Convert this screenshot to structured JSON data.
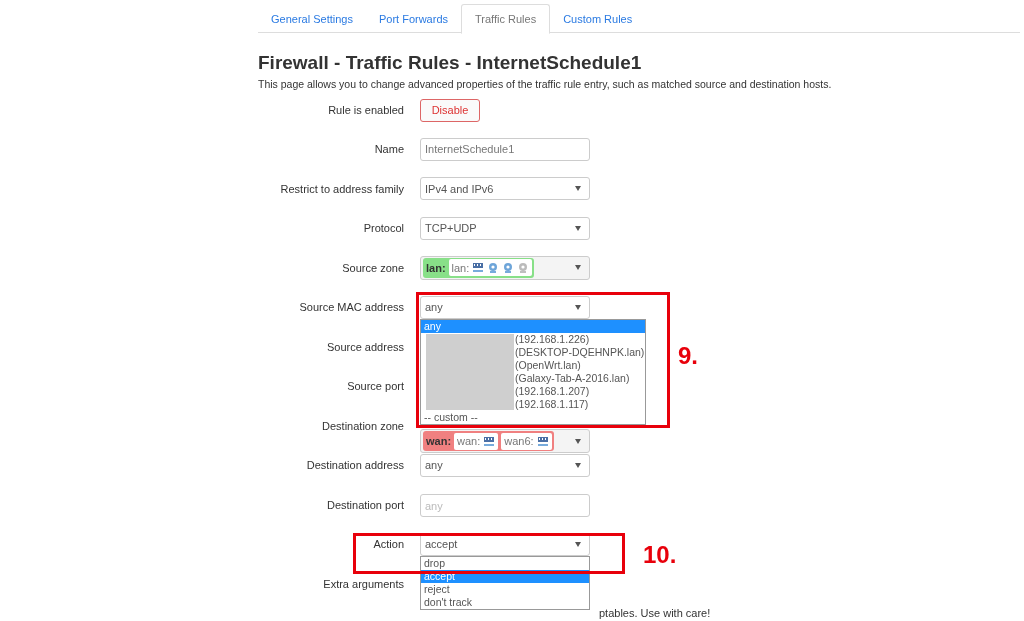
{
  "tabs": [
    {
      "label": "General Settings",
      "selected": false
    },
    {
      "label": "Port Forwards",
      "selected": false
    },
    {
      "label": "Traffic Rules",
      "selected": true
    },
    {
      "label": "Custom Rules",
      "selected": false
    }
  ],
  "title": "Firewall - Traffic Rules - InternetSchedule1",
  "description": "This page allows you to change advanced properties of the traffic rule entry, such as matched source and destination hosts.",
  "fields": [
    {
      "kind": "button",
      "label": "Rule is enabled",
      "value": "Disable"
    },
    {
      "kind": "input",
      "label": "Name",
      "value": "InternetSchedule1"
    },
    {
      "kind": "select",
      "label": "Restrict to address family",
      "value": "IPv4 and IPv6"
    },
    {
      "kind": "select",
      "label": "Protocol",
      "value": "TCP+UDP"
    },
    {
      "kind": "zone",
      "label": "Source zone",
      "zone": {
        "name": "lan:",
        "color": "#88e088",
        "networks": [
          {
            "label": "lan:",
            "devices": [
              {
                "kind": "switch"
              },
              {
                "kind": "wifi"
              },
              {
                "kind": "wifi"
              },
              {
                "kind": "wifi-off"
              }
            ]
          }
        ]
      }
    },
    {
      "kind": "select",
      "label": "Source MAC address",
      "value": "any",
      "options": [
        {
          "label": "any",
          "selected": true
        },
        {
          "label": "(192.168.1.226)",
          "selected": false
        },
        {
          "label": "(DESKTOP-DQEHNPK.lan)",
          "selected": false
        },
        {
          "label": "(OpenWrt.lan)",
          "selected": false
        },
        {
          "label": "(Galaxy-Tab-A-2016.lan)",
          "selected": false
        },
        {
          "label": "(192.168.1.207)",
          "selected": false
        },
        {
          "label": "(192.168.1.117)",
          "selected": false
        },
        {
          "label": "-- custom --",
          "selected": false
        }
      ]
    },
    {
      "kind": "label",
      "label": "Source address"
    },
    {
      "kind": "label",
      "label": "Source port"
    },
    {
      "kind": "zone",
      "label": "Destination zone",
      "zone": {
        "name": "wan:",
        "color": "#f08080",
        "networks": [
          {
            "label": "wan:",
            "devices": [
              {
                "kind": "switch"
              }
            ]
          },
          {
            "label": "wan6:",
            "devices": [
              {
                "kind": "switch"
              }
            ]
          }
        ]
      }
    },
    {
      "kind": "select",
      "label": "Destination address",
      "value": "any"
    },
    {
      "kind": "input",
      "label": "Destination port",
      "placeholder": "any"
    },
    {
      "kind": "select",
      "label": "Action",
      "value": "accept",
      "options": [
        {
          "label": "drop",
          "selected": false
        },
        {
          "label": "accept",
          "selected": true
        },
        {
          "label": "reject",
          "selected": false
        },
        {
          "label": "don't track",
          "selected": false
        }
      ]
    },
    {
      "kind": "label",
      "label": "Extra arguments"
    }
  ],
  "hint": "ptables. Use with care!",
  "annotations": [
    {
      "label": "9."
    },
    {
      "label": "10."
    }
  ]
}
